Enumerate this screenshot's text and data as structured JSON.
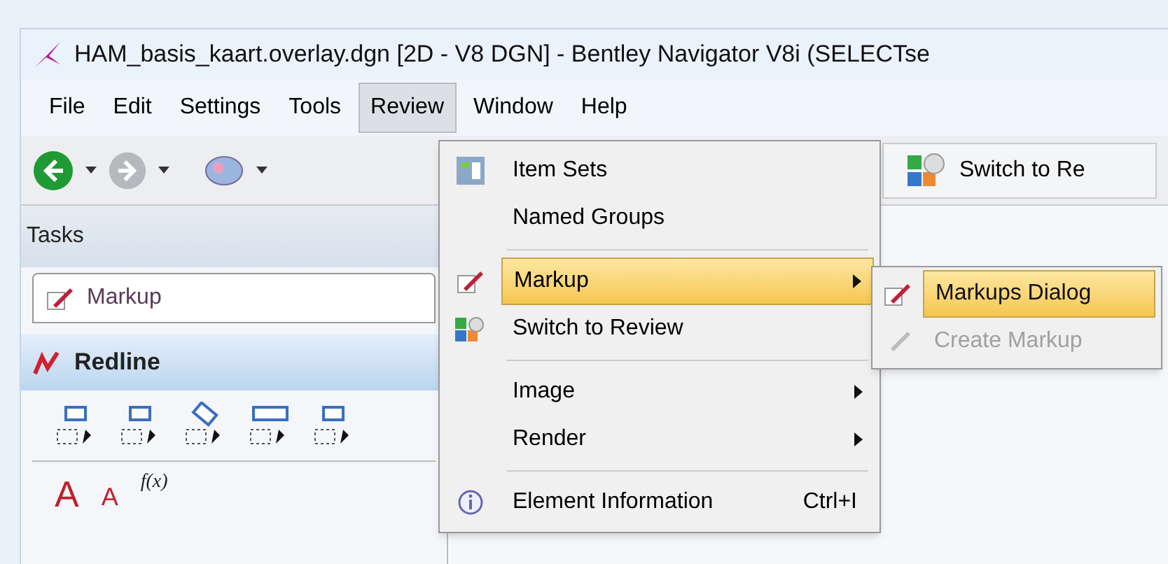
{
  "window": {
    "title": "HAM_basis_kaart.overlay.dgn [2D - V8 DGN] - Bentley Navigator V8i (SELECTse"
  },
  "menu_bar": [
    {
      "label": "File",
      "selected": false
    },
    {
      "label": "Edit",
      "selected": false
    },
    {
      "label": "Settings",
      "selected": false
    },
    {
      "label": "Tools",
      "selected": false
    },
    {
      "label": "Review",
      "selected": true
    },
    {
      "label": "Window",
      "selected": false
    },
    {
      "label": "Help",
      "selected": false
    }
  ],
  "toolbar": {
    "switch_button": "Switch to Re"
  },
  "tasks": {
    "title": "Tasks",
    "dropdown": "Markup",
    "section": "Redline",
    "text_tools": [
      "A",
      "A",
      "f(x)"
    ]
  },
  "review_menu": [
    {
      "kind": "item",
      "label": "Item Sets",
      "highlighted": false,
      "submenu": false
    },
    {
      "kind": "item",
      "label": "Named Groups",
      "highlighted": false,
      "submenu": false
    },
    {
      "kind": "separator"
    },
    {
      "kind": "item",
      "label": "Markup",
      "highlighted": true,
      "submenu": true
    },
    {
      "kind": "item",
      "label": "Switch to Review",
      "highlighted": false,
      "submenu": false
    },
    {
      "kind": "separator"
    },
    {
      "kind": "item",
      "label": "Image",
      "highlighted": false,
      "submenu": true
    },
    {
      "kind": "item",
      "label": "Render",
      "highlighted": false,
      "submenu": true
    },
    {
      "kind": "separator"
    },
    {
      "kind": "item",
      "label": "Element Information",
      "highlighted": false,
      "submenu": false,
      "shortcut": "Ctrl+I"
    }
  ],
  "markup_submenu": [
    {
      "label": "Markups Dialog",
      "highlighted": true,
      "disabled": false
    },
    {
      "label": "Create Markup",
      "highlighted": false,
      "disabled": true
    }
  ]
}
